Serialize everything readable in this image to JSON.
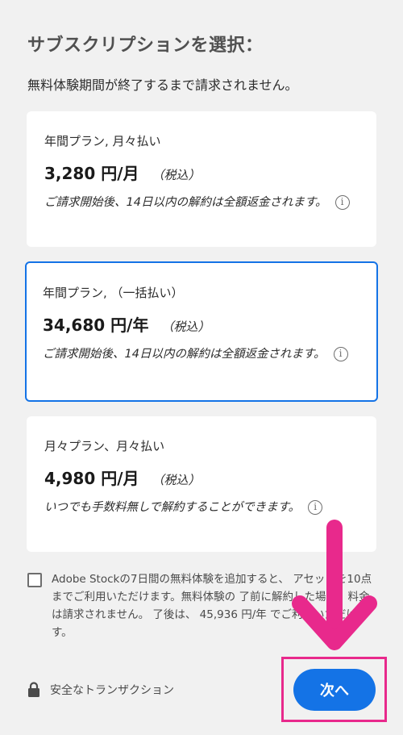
{
  "header": {
    "title": "サブスクリプションを選択：",
    "subtitle": "無料体験期間が終了するまで請求されません。"
  },
  "plans": [
    {
      "name": "年間プラン, 月々払い",
      "price": "3,280 円/月",
      "tax": "（税込）",
      "note": "ご請求開始後、14日以内の解約は全額返金されます。",
      "selected": false
    },
    {
      "name": "年間プラン, （一括払い）",
      "price": "34,680 円/年",
      "tax": "（税込）",
      "note": "ご請求開始後、14日以内の解約は全額返金されます。",
      "selected": true
    },
    {
      "name": "月々プラン、月々払い",
      "price": "4,980 円/月",
      "tax": "（税込）",
      "note": "いつでも手数料無しで解約することができます。",
      "selected": false
    }
  ],
  "addon": {
    "text": "Adobe Stockの7日間の無料体験を追加すると、 アセットを10点までご利用いただけます。無料体験の 了前に解約した場合、料金は請求されません。 了後は、 45,936 円/年 でご利用いただけます。",
    "checked": false
  },
  "footer": {
    "secure_label": "安全なトランザクション",
    "next_label": "次へ"
  },
  "colors": {
    "accent": "#1473e6",
    "annotation": "#e8298c",
    "background": "#f1f1f1"
  },
  "icons": [
    "info-icon",
    "lock-icon",
    "arrow-down-icon"
  ]
}
